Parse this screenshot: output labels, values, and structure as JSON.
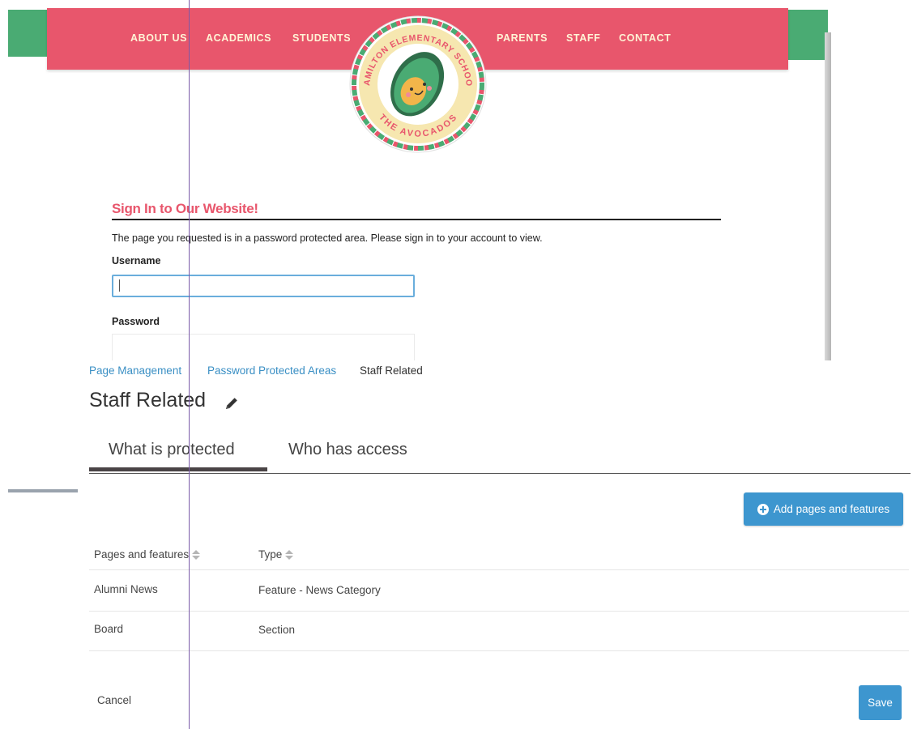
{
  "site": {
    "nav_left": [
      "ABOUT US",
      "ACADEMICS",
      "STUDENTS"
    ],
    "nav_right": [
      "PARENTS",
      "STAFF",
      "CONTACT"
    ],
    "logo_top_text": "HAMILTON ELEMENTARY SCHOOL",
    "logo_bottom_text": "THE AVOCADOS",
    "signin_heading": "Sign In to Our Website!",
    "signin_message": "The page you requested is in a password protected area. Please sign in to your account to view.",
    "username_label": "Username",
    "username_value": "",
    "password_label": "Password",
    "colors": {
      "nav": "#e8566c",
      "accent_green": "#4aab73",
      "heading": "#e8566c"
    }
  },
  "breadcrumb": {
    "items": [
      "Page Management",
      "Password Protected Areas",
      "Staff Related"
    ]
  },
  "page": {
    "title": "Staff Related",
    "edit_icon": "pencil-icon"
  },
  "tabs": [
    {
      "label": "What is protected",
      "active": true
    },
    {
      "label": "Who has access",
      "active": false
    }
  ],
  "toolbar": {
    "add_label": "Add pages and features",
    "add_icon": "plus-circle-icon"
  },
  "table": {
    "columns": [
      "Pages and features",
      "Type"
    ],
    "rows": [
      {
        "name": "Alumni News",
        "type": "Feature - News Category"
      },
      {
        "name": "Board",
        "type": "Section"
      }
    ]
  },
  "footer": {
    "cancel_label": "Cancel",
    "save_label": "Save"
  },
  "colors": {
    "primary_button": "#3d96cf",
    "link": "#3a8fc4"
  }
}
